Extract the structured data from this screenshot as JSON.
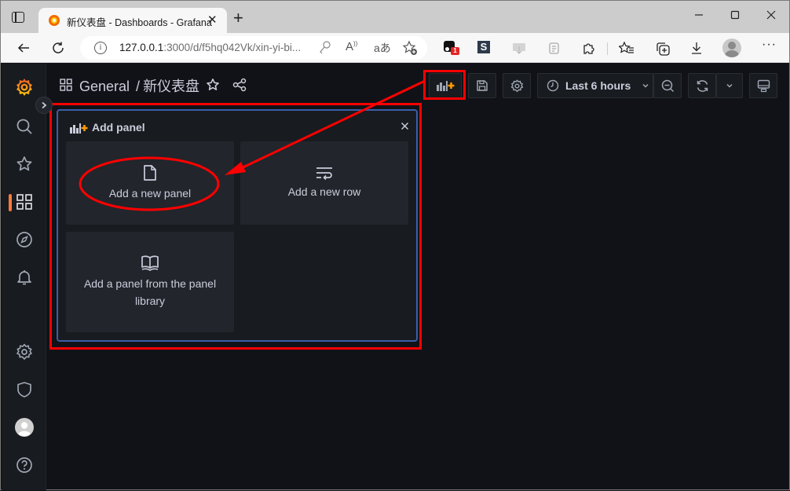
{
  "browser": {
    "tab_title": "新仪表盘 - Dashboards - Grafana",
    "url_host": "127.0.0.1",
    "url_rest": ":3000/d/f5hq042Vk/xin-yi-bi...",
    "extension_badge": "1",
    "extension_s_label": "S",
    "window_controls": [
      "minimize",
      "maximize",
      "close"
    ]
  },
  "sidebar": {
    "items": [
      {
        "name": "grafana-logo"
      },
      {
        "name": "search"
      },
      {
        "name": "starred"
      },
      {
        "name": "dashboards",
        "active": true
      },
      {
        "name": "explore"
      },
      {
        "name": "alerting"
      },
      {
        "name": "configuration"
      },
      {
        "name": "server-admin"
      },
      {
        "name": "profile"
      },
      {
        "name": "help"
      }
    ],
    "active_color": "#ff7a3c"
  },
  "header": {
    "folder": "General",
    "separator": "/",
    "dashboard": "新仪表盘",
    "time_range": "Last 6 hours"
  },
  "add_panel": {
    "title": "Add panel",
    "options": [
      {
        "label": "Add a new panel",
        "icon": "file-icon"
      },
      {
        "label": "Add a new row",
        "icon": "row-wrap-icon"
      },
      {
        "label": "Add a panel from the panel library",
        "icon": "book-icon"
      }
    ]
  },
  "colors": {
    "accent_orange": "#ff9900",
    "annotation_red": "#ff0000",
    "panel_border": "#3b5ea8"
  }
}
